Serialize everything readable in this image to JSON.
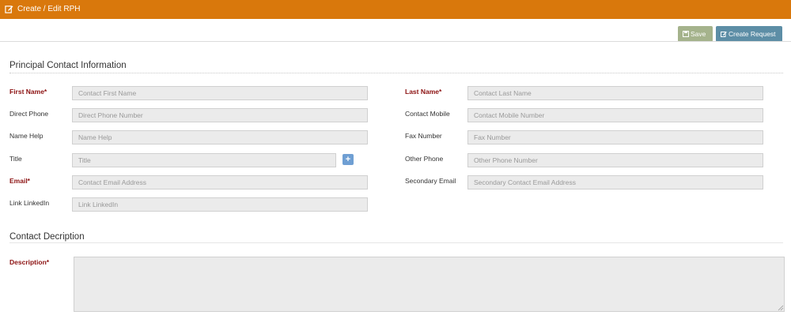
{
  "header": {
    "title": "Create / Edit RPH",
    "icon": "edit-icon",
    "color": "#d9780c"
  },
  "toolbar": {
    "save_label": "Save",
    "create_request_label": "Create Request",
    "save_color": "#a5b38c",
    "request_color": "#5d8ea6"
  },
  "principal_contact": {
    "heading": "Principal Contact Information",
    "first_name": {
      "label": "First Name*",
      "placeholder": "Contact First Name"
    },
    "last_name": {
      "label": "Last Name*",
      "placeholder": "Contact Last Name"
    },
    "direct_phone": {
      "label": "Direct Phone",
      "placeholder": "Direct Phone Number"
    },
    "contact_mobile": {
      "label": "Contact Mobile",
      "placeholder": "Contact Mobile Number"
    },
    "name_help": {
      "label": "Name Help",
      "placeholder": "Name Help"
    },
    "fax_number": {
      "label": "Fax Number",
      "placeholder": "Fax Number"
    },
    "title": {
      "label": "Title",
      "placeholder": "Title",
      "add_label": "+"
    },
    "other_phone": {
      "label": "Other Phone",
      "placeholder": "Other Phone Number"
    },
    "email": {
      "label": "Email*",
      "placeholder": "Contact Email Address"
    },
    "secondary_email": {
      "label": "Secondary Email",
      "placeholder": "Secondary Contact Email Address"
    },
    "linkedin": {
      "label": "Link LinkedIn",
      "placeholder": "Link LinkedIn"
    }
  },
  "contact_description": {
    "heading": "Contact Decription",
    "description": {
      "label": "Description*"
    }
  }
}
